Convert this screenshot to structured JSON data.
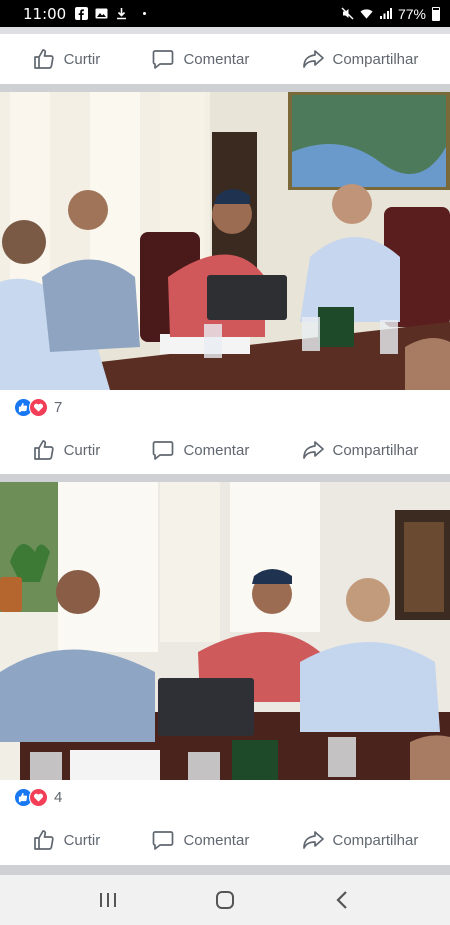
{
  "status_bar": {
    "time": "11:00",
    "battery": "77%",
    "icons": [
      "facebook-icon",
      "messenger-icon",
      "gallery-icon",
      "download-icon",
      "dot-icon",
      "mute-icon",
      "wifi-icon",
      "signal-icon",
      "battery-icon"
    ]
  },
  "actions": {
    "like": "Curtir",
    "comment": "Comentar",
    "share": "Compartilhar"
  },
  "posts": [
    {
      "reaction_count": "7"
    },
    {
      "reaction_count": "4"
    }
  ],
  "colors": {
    "facebook_blue": "#1877f2",
    "love_red": "#f33e58",
    "action_gray": "#606770"
  },
  "nav": {
    "icons": [
      "recent-apps-icon",
      "home-icon",
      "back-icon"
    ]
  }
}
